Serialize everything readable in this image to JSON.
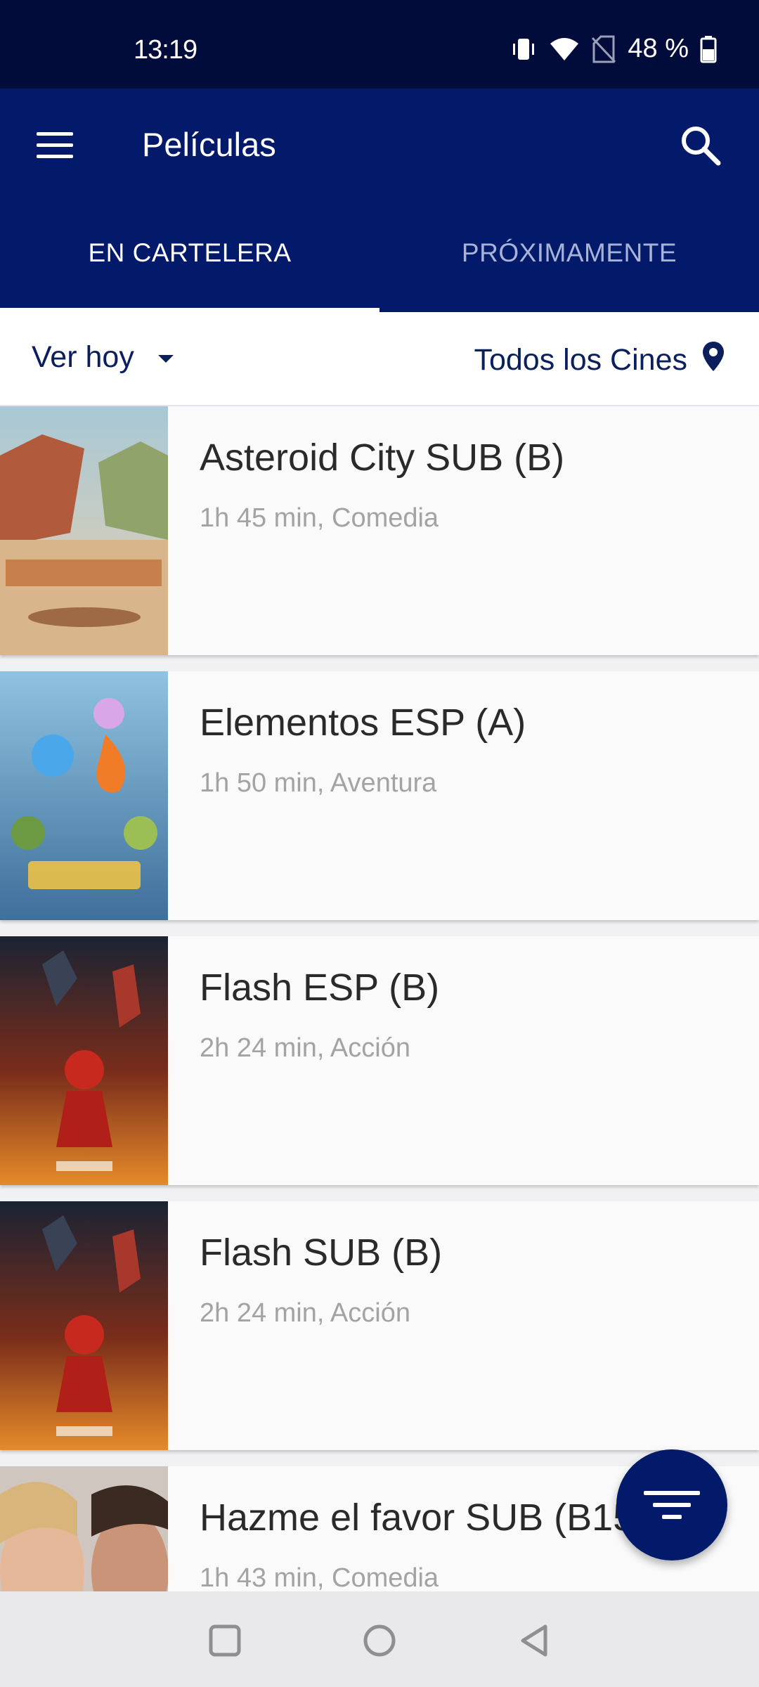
{
  "status_bar": {
    "time": "13:19",
    "battery": "48 %"
  },
  "app_bar": {
    "title": "Películas"
  },
  "tabs": [
    {
      "label": "EN CARTELERA",
      "active": true
    },
    {
      "label": "PRÓXIMAMENTE",
      "active": false
    }
  ],
  "filters": {
    "day": "Ver hoy",
    "cinema": "Todos los Cines"
  },
  "movies": [
    {
      "title": "Asteroid City SUB (B)",
      "meta": "1h 45 min, Comedia"
    },
    {
      "title": "Elementos ESP (A)",
      "meta": "1h 50 min, Aventura"
    },
    {
      "title": "Flash ESP (B)",
      "meta": "2h 24 min, Acción"
    },
    {
      "title": "Flash SUB (B)",
      "meta": "2h 24 min, Acción"
    },
    {
      "title": "Hazme el favor SUB (B15)",
      "meta": "1h 43 min, Comedia"
    }
  ],
  "colors": {
    "primary": "#031a6b",
    "status_bar": "#020c3a",
    "accent_text": "#0b1f5c"
  }
}
